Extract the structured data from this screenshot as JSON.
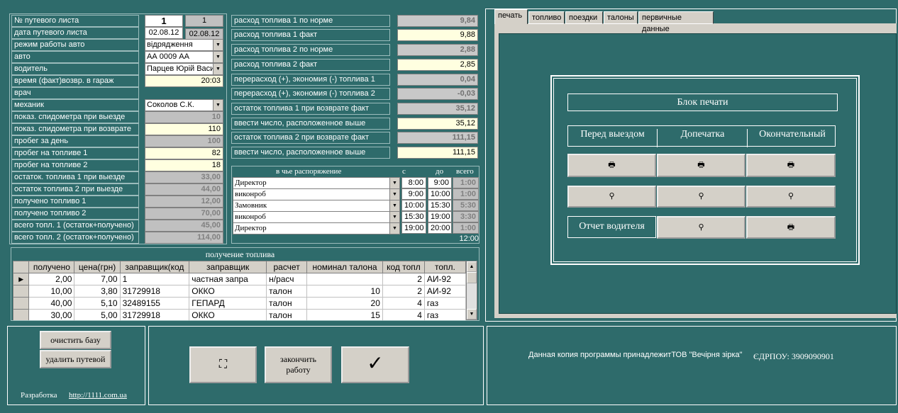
{
  "trip": {
    "labels": [
      "№ путевого листа",
      "дата путевого листа",
      "режим работы авто",
      "авто",
      "водитель",
      "время (факт)возвр. в гараж",
      "врач",
      "механик",
      "показ. спидометра при выезде",
      "показ. спидометра при возврате",
      "пробег за день",
      "пробег на топливе 1",
      "пробег на топливе 2",
      "остаток. топлива 1 при выезде",
      "остаток топлива 2 при выезде",
      "получено топливо 1",
      "получено топливо 2",
      "всего топл. 1 (остаток+получено)",
      "всего топл. 2 (остаток+получено)"
    ],
    "number_input": "1",
    "number_display": "1",
    "date_input": "02.08.12",
    "date_display": "02.08.12",
    "mode": "відрядження",
    "auto": "АА 0009 АА",
    "driver": "Парцев Юрій Васи",
    "return_time": "20:03",
    "doctor": "",
    "mechanic": "Соколов С.К.",
    "odo_out": "10",
    "odo_in": "110",
    "mileage_day": "100",
    "mileage_fuel1": "82",
    "mileage_fuel2": "18",
    "rest1_out": "33,00",
    "rest2_out": "44,00",
    "received1": "12,00",
    "received2": "70,00",
    "total1": "45,00",
    "total2": "114,00"
  },
  "consumption": {
    "labels": [
      "расход топлива 1 по норме",
      "расход топлива 1 факт",
      "расход топлива 2 по норме",
      "расход топлива 2 факт",
      "перерасход (+), экономия (-) топлива 1",
      "перерасход (+), экономия (-) топлива 2",
      "остаток топлива 1 при возврате факт",
      "ввести число, расположенное выше",
      "остаток топлива 2 при возврате факт",
      "ввести число, расположенное выше"
    ],
    "values": [
      "9,84",
      "9,88",
      "2,88",
      "2,85",
      "0,04",
      "-0,03",
      "35,12",
      "35,12",
      "111,15",
      "111,15"
    ]
  },
  "disposal": {
    "headers": [
      "в чье распоряжение",
      "с",
      "до",
      "всего"
    ],
    "rows": [
      {
        "who": "Директор",
        "from": "8:00",
        "to": "9:00",
        "total": "1:00"
      },
      {
        "who": "виконроб",
        "from": "9:00",
        "to": "10:00",
        "total": "1:00"
      },
      {
        "who": "Замовник",
        "from": "10:00",
        "to": "15:30",
        "total": "5:30"
      },
      {
        "who": "виконроб",
        "from": "15:30",
        "to": "19:00",
        "total": "3:30"
      },
      {
        "who": "Директор",
        "from": "19:00",
        "to": "20:00",
        "total": "1:00"
      }
    ],
    "sum": "12:00"
  },
  "fuel": {
    "title": "получение топлива",
    "headers": [
      "получено",
      "цена(грн)",
      "заправщик(код",
      "заправщик",
      "расчет",
      "номинал талона",
      "код топл",
      "топл."
    ],
    "rows": [
      [
        "2,00",
        "7,00",
        "1",
        "частная запра",
        "н/расч",
        "",
        "2",
        "АИ-92"
      ],
      [
        "10,00",
        "3,80",
        "31729918",
        "ОККО",
        "талон",
        "10",
        "2",
        "АИ-92"
      ],
      [
        "40,00",
        "5,10",
        "32489155",
        "ГЕПАРД",
        "талон",
        "20",
        "4",
        "газ"
      ],
      [
        "30,00",
        "5,00",
        "31729918",
        "ОККО",
        "талон",
        "15",
        "4",
        "газ"
      ]
    ]
  },
  "tabs": [
    "печать",
    "топливо",
    "поездки",
    "талоны",
    "первичные данные"
  ],
  "print": {
    "block_title": "Блок печати",
    "col_headers": [
      "Перед выездом",
      "Допечатка",
      "Окончательный"
    ],
    "driver_report": "Отчет водителя"
  },
  "bottom": {
    "clear_db": "очистить базу",
    "delete_trip": "удалить путевой",
    "dev_label": "Разработка",
    "dev_link": "http://1111.com.ua",
    "finish_line1": "закончить",
    "finish_line2": "работу",
    "copyright": "Данная копия программы принадлежитТОВ \"Вечірня зірка\"",
    "edrpou": "ЄДРПОУ: 3909090901"
  },
  "icons": {
    "printer": "printer-icon",
    "magnifier": "magnifier-icon",
    "binoculars": "binoculars-icon",
    "check": "checkmark-icon"
  },
  "colors": {
    "background": "#2e6b6b",
    "field_yellow": "#ffffe0",
    "button": "#d4d0c8"
  }
}
